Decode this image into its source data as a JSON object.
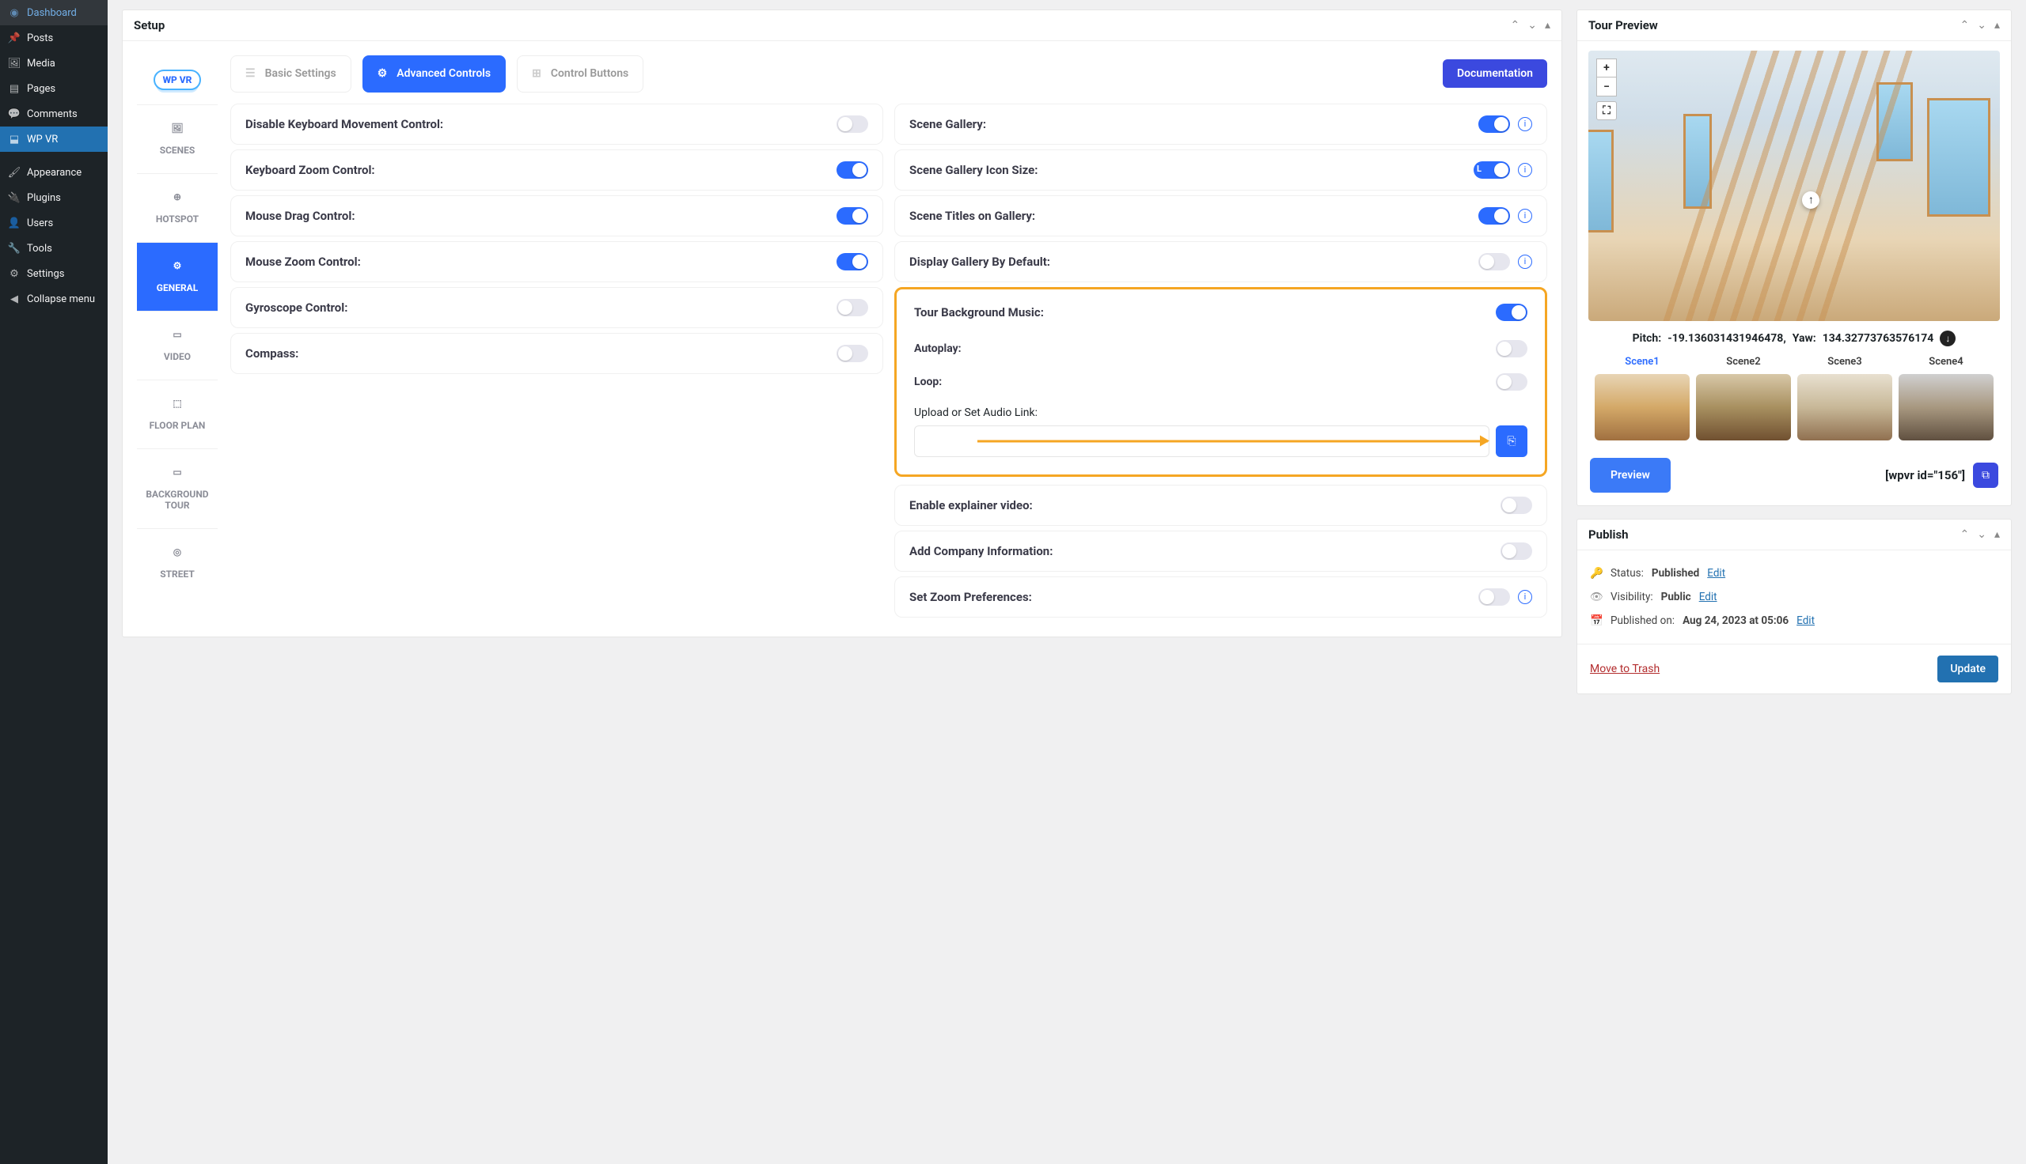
{
  "sidebar": {
    "items": [
      {
        "label": "Dashboard",
        "icon": "dashboard"
      },
      {
        "label": "Posts",
        "icon": "pin"
      },
      {
        "label": "Media",
        "icon": "media"
      },
      {
        "label": "Pages",
        "icon": "page"
      },
      {
        "label": "Comments",
        "icon": "comment"
      },
      {
        "label": "WP VR",
        "icon": "vr",
        "active": true
      },
      {
        "label": "Appearance",
        "icon": "brush"
      },
      {
        "label": "Plugins",
        "icon": "plug"
      },
      {
        "label": "Users",
        "icon": "user"
      },
      {
        "label": "Tools",
        "icon": "wrench"
      },
      {
        "label": "Settings",
        "icon": "gear"
      },
      {
        "label": "Collapse menu",
        "icon": "collapse"
      }
    ]
  },
  "setup": {
    "title": "Setup",
    "logo_text": "WP VR",
    "vtabs": [
      {
        "label": "SCENES"
      },
      {
        "label": "HOTSPOT"
      },
      {
        "label": "GENERAL",
        "active": true
      },
      {
        "label": "VIDEO"
      },
      {
        "label": "FLOOR PLAN"
      },
      {
        "label": "BACKGROUND TOUR"
      },
      {
        "label": "STREET"
      }
    ],
    "htabs": {
      "basic": "Basic Settings",
      "advanced": "Advanced Controls",
      "buttons": "Control Buttons",
      "doc": "Documentation"
    },
    "left_controls": [
      {
        "label": "Disable Keyboard Movement Control:",
        "on": false
      },
      {
        "label": "Keyboard Zoom Control:",
        "on": true
      },
      {
        "label": "Mouse Drag Control:",
        "on": true
      },
      {
        "label": "Mouse Zoom Control:",
        "on": true
      },
      {
        "label": "Gyroscope Control:",
        "on": false
      },
      {
        "label": "Compass:",
        "on": false
      }
    ],
    "right_controls": [
      {
        "label": "Scene Gallery:",
        "on": true,
        "info": true
      },
      {
        "label": "Scene Gallery Icon Size:",
        "on": true,
        "info": true,
        "badge": "L"
      },
      {
        "label": "Scene Titles on Gallery:",
        "on": true,
        "info": true
      },
      {
        "label": "Display Gallery By Default:",
        "on": false,
        "info": true
      }
    ],
    "music": {
      "label": "Tour Background Music:",
      "on": true,
      "autoplay_label": "Autoplay:",
      "autoplay_on": false,
      "loop_label": "Loop:",
      "loop_on": false,
      "upload_label": "Upload or Set Audio Link:"
    },
    "right_controls2": [
      {
        "label": "Enable explainer video:",
        "on": false
      },
      {
        "label": "Add Company Information:",
        "on": false
      },
      {
        "label": "Set Zoom Preferences:",
        "on": false,
        "info": true
      }
    ]
  },
  "preview": {
    "title": "Tour Preview",
    "zoom_in": "+",
    "zoom_out": "−",
    "pitch_label": "Pitch:",
    "pitch_value": "-19.136031431946478,",
    "yaw_label": "Yaw:",
    "yaw_value": "134.32773763576174",
    "scenes": [
      "Scene1",
      "Scene2",
      "Scene3",
      "Scene4"
    ],
    "preview_btn": "Preview",
    "shortcode": "[wpvr id=\"156\"]"
  },
  "publish": {
    "title": "Publish",
    "status_label": "Status:",
    "status_value": "Published",
    "visibility_label": "Visibility:",
    "visibility_value": "Public",
    "published_label": "Published on:",
    "published_value": "Aug 24, 2023 at 05:06",
    "edit": "Edit",
    "trash": "Move to Trash",
    "update": "Update"
  }
}
